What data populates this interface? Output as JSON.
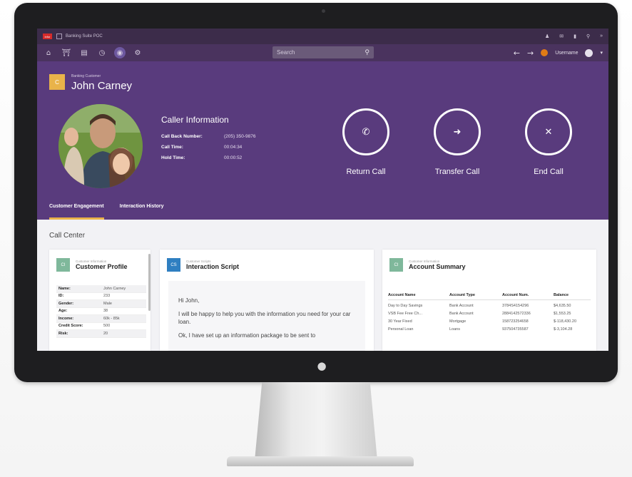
{
  "titlebar": {
    "app_badge": "infor",
    "title": "Banking Suite POC"
  },
  "search": {
    "placeholder": "Search"
  },
  "navbar": {
    "username": "Username"
  },
  "customer": {
    "badge": "C",
    "type": "Banking Customer",
    "name": "John Carney"
  },
  "caller": {
    "title": "Caller Information",
    "rows": [
      {
        "label": "Call Back Number:",
        "value": "(205) 350-9876"
      },
      {
        "label": "Call Time:",
        "value": "00:04:34"
      },
      {
        "label": "Hold Time:",
        "value": "00:00:52"
      }
    ]
  },
  "actions": [
    {
      "label": "Return Call",
      "icon": "phone-icon"
    },
    {
      "label": "Transfer Call",
      "icon": "forward-icon"
    },
    {
      "label": "End Call",
      "icon": "close-icon"
    }
  ],
  "tabs": [
    {
      "label": "Customer Engagement",
      "active": true
    },
    {
      "label": "Interaction History",
      "active": false
    }
  ],
  "section_title": "Call Center",
  "profile_card": {
    "badge": "CI",
    "badge_color": "#7fb89b",
    "subtitle": "Customer Information",
    "title": "Customer Profile",
    "rows": [
      {
        "k": "Name:",
        "v": "John Carney"
      },
      {
        "k": "ID:",
        "v": "233"
      },
      {
        "k": "Gender:",
        "v": "Male"
      },
      {
        "k": "Age:",
        "v": "38"
      },
      {
        "k": "Income:",
        "v": "60k - 85k"
      },
      {
        "k": "Credit Score:",
        "v": "500"
      },
      {
        "k": "Risk:",
        "v": "20"
      }
    ]
  },
  "script_card": {
    "badge": "CS",
    "badge_color": "#2f7fc1",
    "subtitle": "Customer Scripts",
    "title": "Interaction Script",
    "lines": [
      "Hi John,",
      "I will be happy to help you with the information you need for your car loan.",
      "Ok, I have set up an information package to be sent to"
    ]
  },
  "account_card": {
    "badge": "CI",
    "badge_color": "#7fb89b",
    "subtitle": "Customer Information",
    "title": "Account Summary",
    "headers": [
      "Account Name",
      "Account Type",
      "Account Num.",
      "Balance"
    ],
    "rows": [
      [
        "Day to Day Savings",
        "Bank Account",
        "3784S4154296",
        "$4,635.50"
      ],
      [
        "VSB Fee Free Ch...",
        "Bank Account",
        "2884142572336",
        "$1,553.25"
      ],
      [
        "30 Year Fixed",
        "Mortgage",
        "158723254658",
        "$-118,430.20"
      ],
      [
        "Personal Loan",
        "Loans",
        "937504735587",
        "$-3,104.28"
      ]
    ]
  },
  "colors": {
    "hero": "#593b7d",
    "navbar": "#4a335e",
    "titlebar": "#3c2c4a",
    "accent": "#e9b34a"
  }
}
